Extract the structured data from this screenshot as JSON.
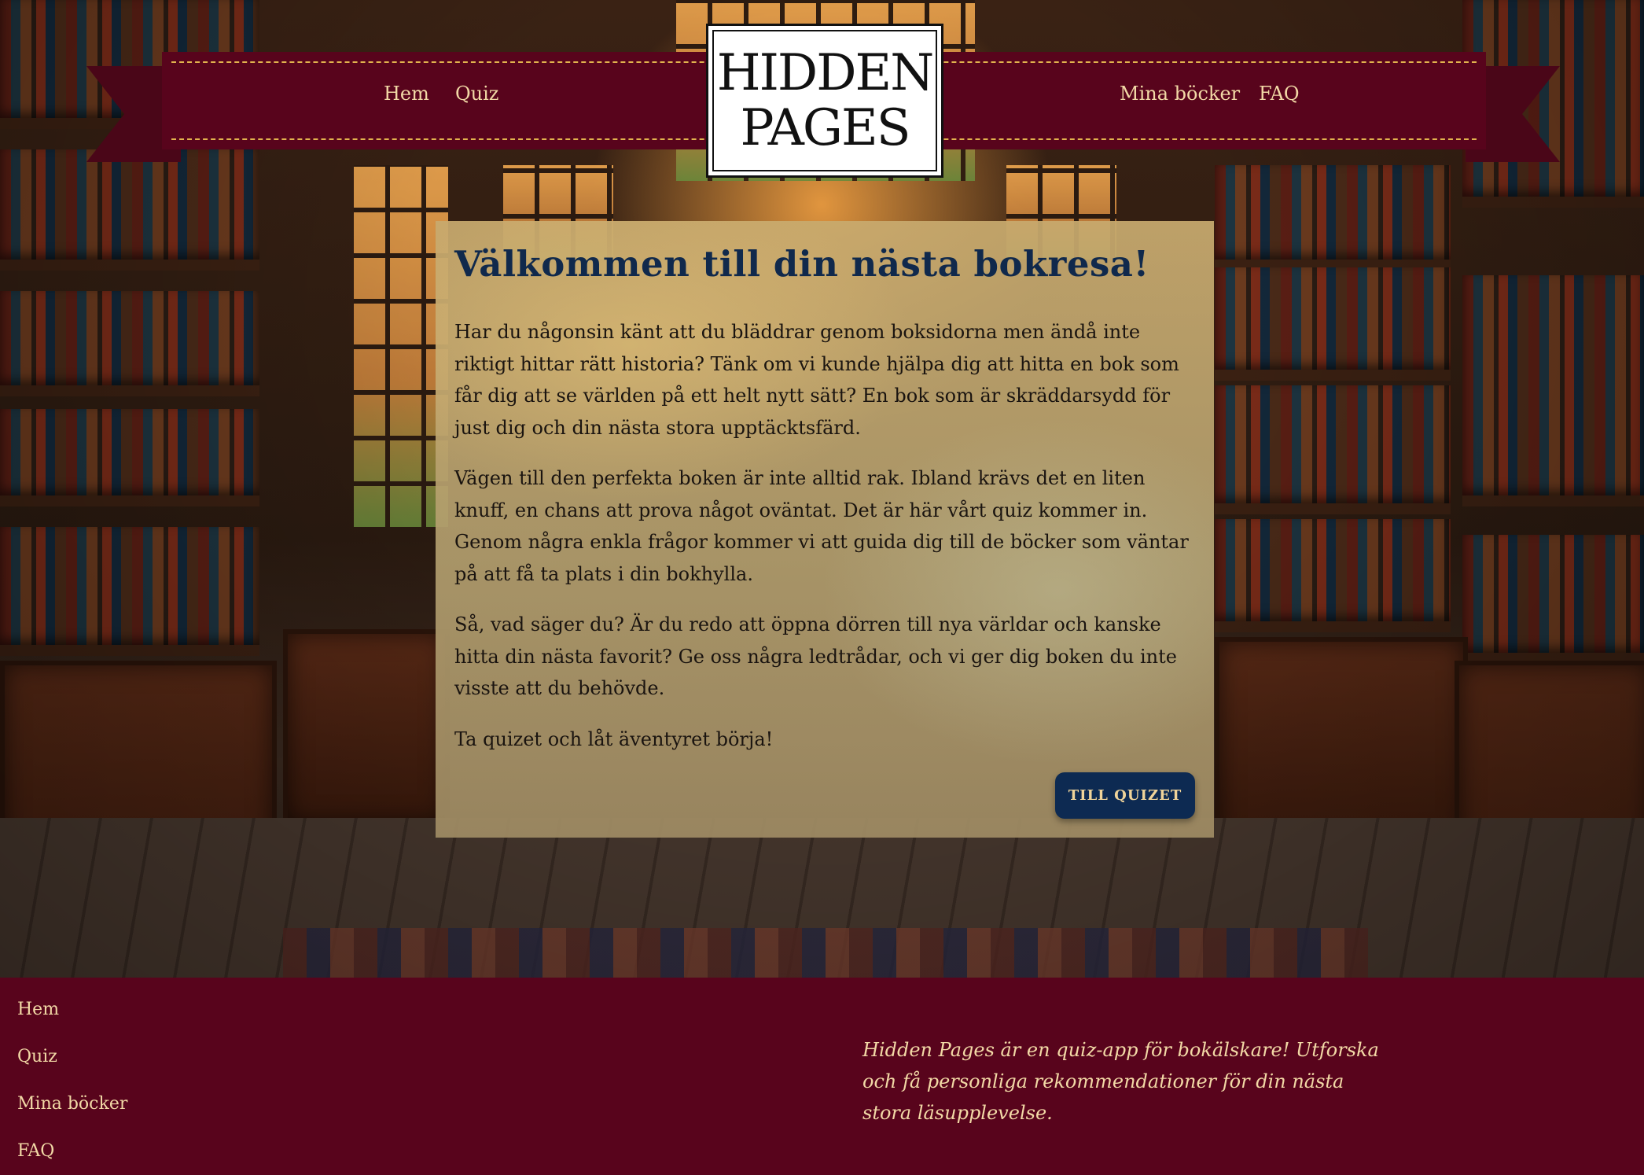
{
  "header": {
    "nav_left": [
      "Hem",
      "Quiz"
    ],
    "nav_right": [
      "Mina böcker",
      "FAQ"
    ],
    "logo_line1": "HIDDEN",
    "logo_line2": "PAGES"
  },
  "main": {
    "title": "Välkommen till din nästa bokresa!",
    "paragraphs": [
      "Har du någonsin känt att du bläddrar genom boksidorna men ändå inte riktigt hittar rätt historia? Tänk om vi kunde hjälpa dig att hitta en bok som får dig att se världen på ett helt nytt sätt? En bok som är skräddarsydd för just dig och din nästa stora upptäcktsfärd.",
      "Vägen till den perfekta boken är inte alltid rak. Ibland krävs det en liten knuff, en chans att prova något oväntat. Det är här vårt quiz kommer in. Genom några enkla frågor kommer vi att guida dig till de böcker som väntar på att få ta plats i din bokhylla.",
      "Så, vad säger du? Är du redo att öppna dörren till nya världar och kanske hitta din nästa favorit? Ge oss några ledtrådar, och vi ger dig boken du inte visste att du behövde.",
      "Ta quizet och låt äventyret börja!"
    ],
    "cta_label": "TILL QUIZET"
  },
  "footer": {
    "links": [
      "Hem",
      "Quiz",
      "Mina böcker",
      "FAQ"
    ],
    "about": "Hidden Pages är en quiz-app för bokälskare! Utforska och få personliga rekommendationer för din nästa stora läsupplevelse."
  },
  "colors": {
    "banner": "#58041c",
    "accent_gold": "#e2b34e",
    "title_navy": "#10294c",
    "button_navy": "#0d2a52",
    "link_cream": "#f2d9a6"
  }
}
